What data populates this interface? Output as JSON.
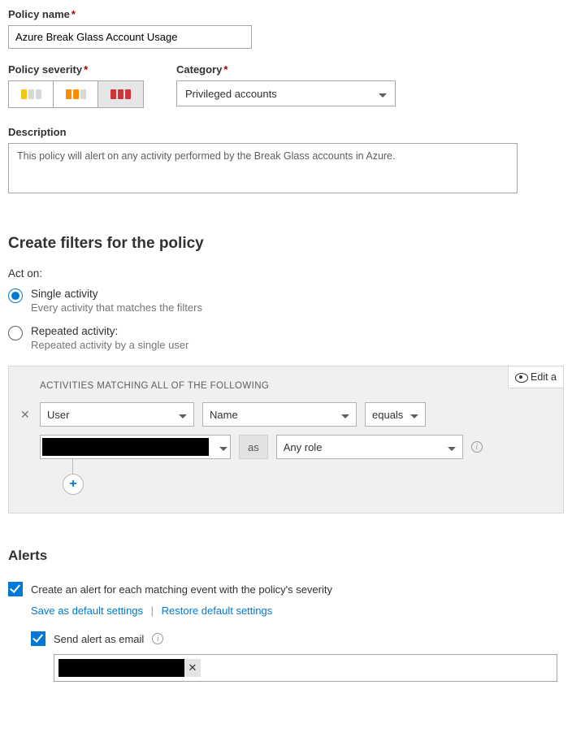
{
  "policyName": {
    "label": "Policy name",
    "value": "Azure Break Glass Account Usage"
  },
  "severity": {
    "label": "Policy severity",
    "selectedIndex": 2
  },
  "category": {
    "label": "Category",
    "value": "Privileged accounts"
  },
  "description": {
    "label": "Description",
    "value": "This policy will alert on any activity performed by the Break Glass accounts in Azure."
  },
  "filters": {
    "heading": "Create filters for the policy",
    "actOnLabel": "Act on:",
    "options": [
      {
        "title": "Single activity",
        "sub": "Every activity that matches the filters",
        "selected": true
      },
      {
        "title": "Repeated activity:",
        "sub": "Repeated activity by a single user",
        "selected": false
      }
    ],
    "boxTitle": "ACTIVITIES MATCHING ALL OF THE FOLLOWING",
    "editLabel": "Edit a",
    "line1": {
      "field": "User",
      "attr": "Name",
      "op": "equals"
    },
    "line2": {
      "asLabel": "as",
      "role": "Any role"
    }
  },
  "alerts": {
    "heading": "Alerts",
    "createAlert": "Create an alert for each matching event with the policy's severity",
    "saveDefault": "Save as default settings",
    "restoreDefault": "Restore default settings",
    "sendEmail": "Send alert as email"
  }
}
